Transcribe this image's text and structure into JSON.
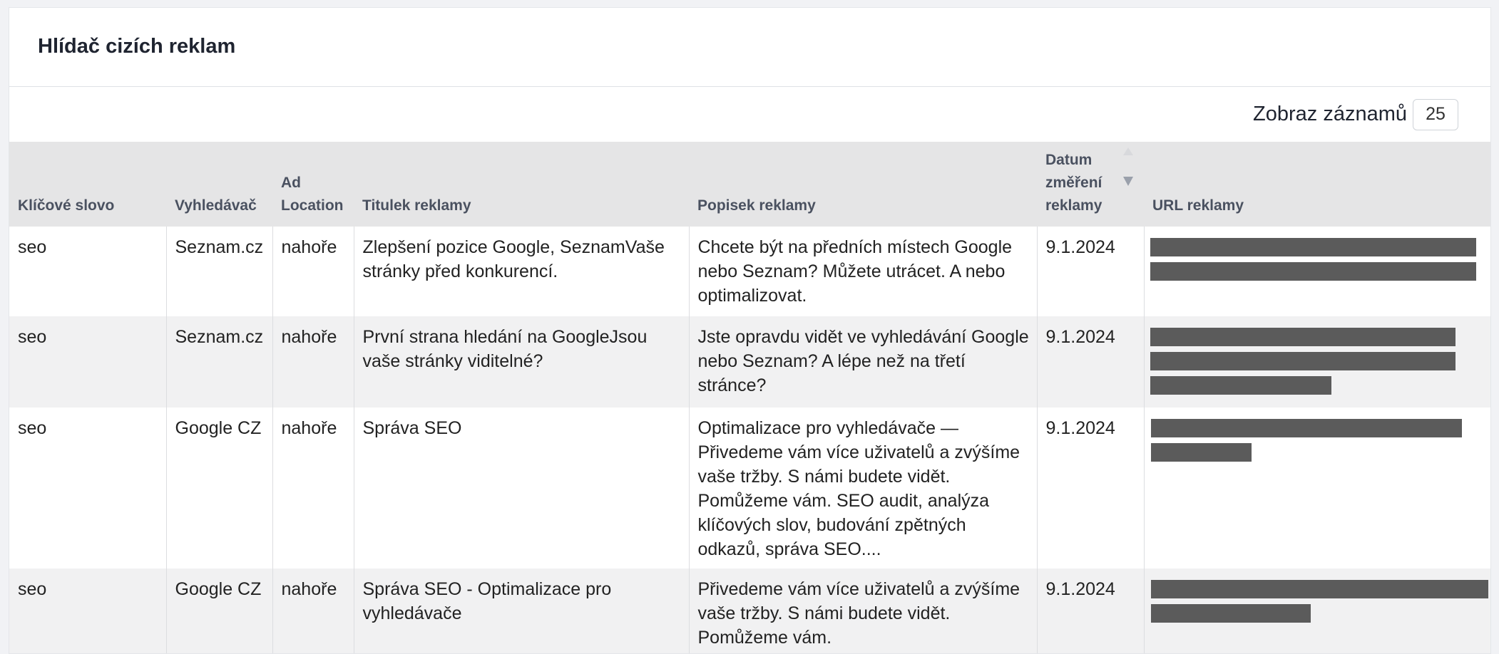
{
  "card": {
    "title": "Hlídač cizích reklam"
  },
  "toolbar": {
    "length_label": "Zobraz záznamů",
    "length_value": "25"
  },
  "table": {
    "columns": [
      "Klíčové slovo",
      "Vyhledávač",
      "Ad Location",
      "Titulek reklamy",
      "Popisek reklamy",
      "Datum změření reklamy",
      "URL reklamy"
    ],
    "sort": {
      "column": "Datum změření reklamy",
      "direction": "descending"
    },
    "rows": [
      {
        "keyword": "seo",
        "engine": "Seznam.cz",
        "location": "nahoře",
        "title": "Zlepšení pozice Google, SeznamVaše stránky před konkurencí.",
        "description": "Chcete být na předních místech Google nebo Seznam? Můžete utrácet. A nebo optimalizovat.",
        "date": "9.1.2024",
        "url_redacted": true
      },
      {
        "keyword": "seo",
        "engine": "Seznam.cz",
        "location": "nahoře",
        "title": "První strana hledání na GoogleJsou vaše stránky viditelné?",
        "description": "Jste opravdu vidět ve vyhledávání Google nebo Seznam? A lépe než na třetí stránce?",
        "date": "9.1.2024",
        "url_redacted": true
      },
      {
        "keyword": "seo",
        "engine": "Google CZ",
        "location": "nahoře",
        "title": "Správa SEO",
        "description": "Optimalizace pro vyhledávače — Přivedeme vám více uživatelů a zvýšíme vaše tržby. S námi budete vidět. Pomůžeme vám. SEO audit, analýza klíčových slov, budování zpětných odkazů, správa SEO....",
        "date": "9.1.2024",
        "url_redacted": true
      },
      {
        "keyword": "seo",
        "engine": "Google CZ",
        "location": "nahoře",
        "title": "Správa SEO - Optimalizace pro vyhledávače",
        "description": "Přivedeme vám více uživatelů a zvýšíme vaše tržby. S námi budete vidět. Pomůžeme vám.",
        "date": "9.1.2024",
        "url_redacted": true
      }
    ]
  }
}
